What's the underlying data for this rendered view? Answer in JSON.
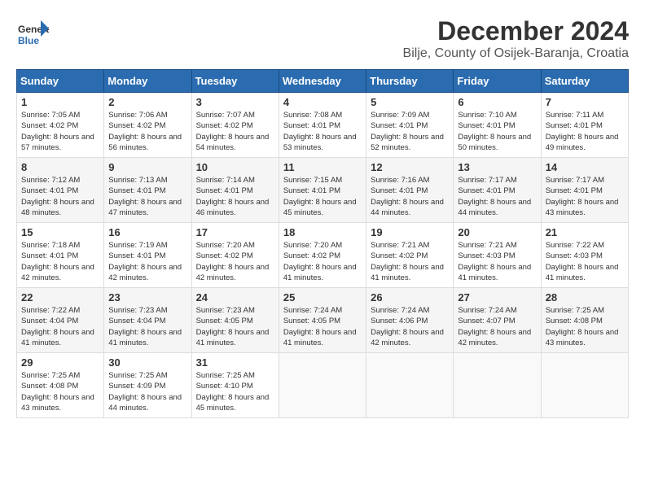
{
  "header": {
    "logo_general": "General",
    "logo_blue": "Blue",
    "month_year": "December 2024",
    "location": "Bilje, County of Osijek-Baranja, Croatia"
  },
  "weekdays": [
    "Sunday",
    "Monday",
    "Tuesday",
    "Wednesday",
    "Thursday",
    "Friday",
    "Saturday"
  ],
  "weeks": [
    [
      {
        "day": "1",
        "sunrise": "7:05 AM",
        "sunset": "4:02 PM",
        "daylight": "8 hours and 57 minutes."
      },
      {
        "day": "2",
        "sunrise": "7:06 AM",
        "sunset": "4:02 PM",
        "daylight": "8 hours and 56 minutes."
      },
      {
        "day": "3",
        "sunrise": "7:07 AM",
        "sunset": "4:02 PM",
        "daylight": "8 hours and 54 minutes."
      },
      {
        "day": "4",
        "sunrise": "7:08 AM",
        "sunset": "4:01 PM",
        "daylight": "8 hours and 53 minutes."
      },
      {
        "day": "5",
        "sunrise": "7:09 AM",
        "sunset": "4:01 PM",
        "daylight": "8 hours and 52 minutes."
      },
      {
        "day": "6",
        "sunrise": "7:10 AM",
        "sunset": "4:01 PM",
        "daylight": "8 hours and 50 minutes."
      },
      {
        "day": "7",
        "sunrise": "7:11 AM",
        "sunset": "4:01 PM",
        "daylight": "8 hours and 49 minutes."
      }
    ],
    [
      {
        "day": "8",
        "sunrise": "7:12 AM",
        "sunset": "4:01 PM",
        "daylight": "8 hours and 48 minutes."
      },
      {
        "day": "9",
        "sunrise": "7:13 AM",
        "sunset": "4:01 PM",
        "daylight": "8 hours and 47 minutes."
      },
      {
        "day": "10",
        "sunrise": "7:14 AM",
        "sunset": "4:01 PM",
        "daylight": "8 hours and 46 minutes."
      },
      {
        "day": "11",
        "sunrise": "7:15 AM",
        "sunset": "4:01 PM",
        "daylight": "8 hours and 45 minutes."
      },
      {
        "day": "12",
        "sunrise": "7:16 AM",
        "sunset": "4:01 PM",
        "daylight": "8 hours and 44 minutes."
      },
      {
        "day": "13",
        "sunrise": "7:17 AM",
        "sunset": "4:01 PM",
        "daylight": "8 hours and 44 minutes."
      },
      {
        "day": "14",
        "sunrise": "7:17 AM",
        "sunset": "4:01 PM",
        "daylight": "8 hours and 43 minutes."
      }
    ],
    [
      {
        "day": "15",
        "sunrise": "7:18 AM",
        "sunset": "4:01 PM",
        "daylight": "8 hours and 42 minutes."
      },
      {
        "day": "16",
        "sunrise": "7:19 AM",
        "sunset": "4:01 PM",
        "daylight": "8 hours and 42 minutes."
      },
      {
        "day": "17",
        "sunrise": "7:20 AM",
        "sunset": "4:02 PM",
        "daylight": "8 hours and 42 minutes."
      },
      {
        "day": "18",
        "sunrise": "7:20 AM",
        "sunset": "4:02 PM",
        "daylight": "8 hours and 41 minutes."
      },
      {
        "day": "19",
        "sunrise": "7:21 AM",
        "sunset": "4:02 PM",
        "daylight": "8 hours and 41 minutes."
      },
      {
        "day": "20",
        "sunrise": "7:21 AM",
        "sunset": "4:03 PM",
        "daylight": "8 hours and 41 minutes."
      },
      {
        "day": "21",
        "sunrise": "7:22 AM",
        "sunset": "4:03 PM",
        "daylight": "8 hours and 41 minutes."
      }
    ],
    [
      {
        "day": "22",
        "sunrise": "7:22 AM",
        "sunset": "4:04 PM",
        "daylight": "8 hours and 41 minutes."
      },
      {
        "day": "23",
        "sunrise": "7:23 AM",
        "sunset": "4:04 PM",
        "daylight": "8 hours and 41 minutes."
      },
      {
        "day": "24",
        "sunrise": "7:23 AM",
        "sunset": "4:05 PM",
        "daylight": "8 hours and 41 minutes."
      },
      {
        "day": "25",
        "sunrise": "7:24 AM",
        "sunset": "4:05 PM",
        "daylight": "8 hours and 41 minutes."
      },
      {
        "day": "26",
        "sunrise": "7:24 AM",
        "sunset": "4:06 PM",
        "daylight": "8 hours and 42 minutes."
      },
      {
        "day": "27",
        "sunrise": "7:24 AM",
        "sunset": "4:07 PM",
        "daylight": "8 hours and 42 minutes."
      },
      {
        "day": "28",
        "sunrise": "7:25 AM",
        "sunset": "4:08 PM",
        "daylight": "8 hours and 43 minutes."
      }
    ],
    [
      {
        "day": "29",
        "sunrise": "7:25 AM",
        "sunset": "4:08 PM",
        "daylight": "8 hours and 43 minutes."
      },
      {
        "day": "30",
        "sunrise": "7:25 AM",
        "sunset": "4:09 PM",
        "daylight": "8 hours and 44 minutes."
      },
      {
        "day": "31",
        "sunrise": "7:25 AM",
        "sunset": "4:10 PM",
        "daylight": "8 hours and 45 minutes."
      },
      null,
      null,
      null,
      null
    ]
  ]
}
